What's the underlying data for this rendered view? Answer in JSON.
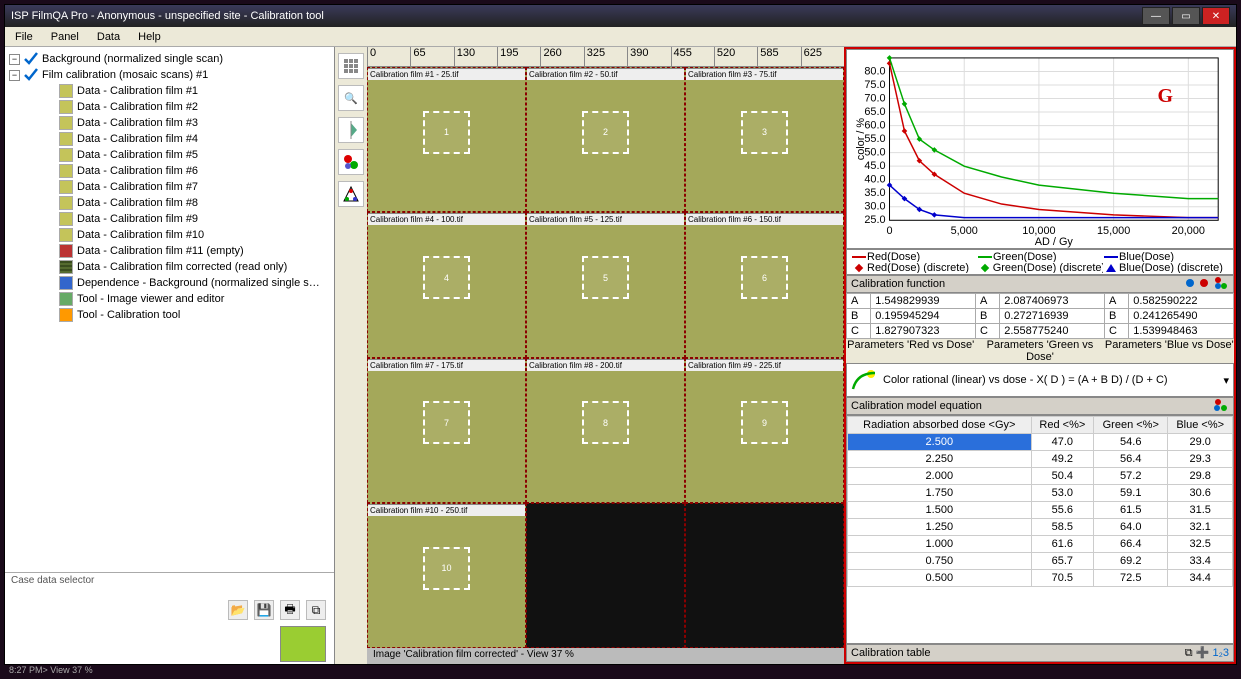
{
  "window": {
    "title": "ISP FilmQA Pro - Anonymous - unspecified site - Calibration tool"
  },
  "menubar": [
    "File",
    "Panel",
    "Data",
    "Help"
  ],
  "tree": {
    "root1": "Background (normalized single scan)",
    "root2": "Film calibration (mosaic scans) #1",
    "items": [
      "Data - Calibration film #1",
      "Data - Calibration film #2",
      "Data - Calibration film #3",
      "Data - Calibration film #4",
      "Data - Calibration film #5",
      "Data - Calibration film #6",
      "Data - Calibration film #7",
      "Data - Calibration film #8",
      "Data - Calibration film #9",
      "Data - Calibration film #10"
    ],
    "empty": "Data - Calibration film #11 (empty)",
    "corrected": "Data - Calibration film corrected (read only)",
    "dep": "Dependence - Background (normalized single s…",
    "tool1": "Tool - Image viewer and editor",
    "tool2": "Tool - Calibration tool"
  },
  "case_selector": "Case data selector",
  "rulerX": [
    "0",
    "65",
    "130",
    "195",
    "260",
    "325",
    "390",
    "455",
    "520",
    "585",
    "625"
  ],
  "filmLabels": [
    "Calibration film #1 - 25.tif",
    "Calibration film #2 - 50.tif",
    "Calibration film #3 - 75.tif",
    "Calibration film #4 - 100.tif",
    "Calibration film #5 - 125.tif",
    "Calibration film #6 - 150.tif",
    "Calibration film #7 - 175.tif",
    "Calibration film #8 - 200.tif",
    "Calibration film #9 - 225.tif",
    "Calibration film #10 - 250.tif",
    "",
    ""
  ],
  "roiNums": [
    "1",
    "2",
    "3",
    "4",
    "5",
    "6",
    "7",
    "8",
    "9",
    "10"
  ],
  "imgcaption": "Image 'Calibration film corrected' - View 37 %",
  "annotG": "G",
  "legend": {
    "r": "Red(Dose)",
    "g": "Green(Dose)",
    "b": "Blue(Dose)",
    "rd": "Red(Dose) (discrete)",
    "gd": "Green(Dose) (discrete)",
    "bd": "Blue(Dose) (discrete)"
  },
  "chart_y_label": "color / %",
  "chart_x_label": "AD / Gy",
  "calfunc_label": "Calibration function",
  "params": {
    "red": {
      "A": "1.549829939",
      "B": "0.195945294",
      "C": "1.827907323"
    },
    "green": {
      "A": "2.087406973",
      "B": "0.272716939",
      "C": "2.558775240"
    },
    "blue": {
      "A": "0.582590222",
      "B": "0.241265490",
      "C": "1.539948463"
    }
  },
  "paramLabels": {
    "r": "Parameters 'Red vs Dose'",
    "g": "Parameters 'Green vs Dose'",
    "b": "Parameters 'Blue vs Dose'"
  },
  "equation_label": "Color rational (linear) vs dose - X( D ) = (A + B D) / (D + C)",
  "modelhdr": "Calibration model equation",
  "caltable": {
    "headers": [
      "Radiation absorbed dose <Gy>",
      "Red <%>",
      "Green <%>",
      "Blue <%>"
    ],
    "rows": [
      [
        "2.500",
        "47.0",
        "54.6",
        "29.0"
      ],
      [
        "2.250",
        "49.2",
        "56.4",
        "29.3"
      ],
      [
        "2.000",
        "50.4",
        "57.2",
        "29.8"
      ],
      [
        "1.750",
        "53.0",
        "59.1",
        "30.6"
      ],
      [
        "1.500",
        "55.6",
        "61.5",
        "31.5"
      ],
      [
        "1.250",
        "58.5",
        "64.0",
        "32.1"
      ],
      [
        "1.000",
        "61.6",
        "66.4",
        "32.5"
      ],
      [
        "0.750",
        "65.7",
        "69.2",
        "33.4"
      ],
      [
        "0.500",
        "70.5",
        "72.5",
        "34.4"
      ]
    ],
    "footer": "Calibration table"
  },
  "footer": "8:27 PM> View 37 %",
  "chart_data": {
    "type": "line",
    "xlabel": "AD / Gy",
    "ylabel": "color / %",
    "xlim": [
      0,
      22000
    ],
    "ylim": [
      25,
      85
    ],
    "x_ticks": [
      0,
      5000,
      10000,
      15000,
      20000
    ],
    "y_ticks": [
      25,
      30,
      35,
      40,
      45,
      50,
      55,
      60,
      65,
      70,
      75,
      80
    ],
    "x": [
      0,
      1000,
      2000,
      3000,
      5000,
      7500,
      10000,
      15000,
      20000,
      22000
    ],
    "series": [
      {
        "name": "Red(Dose)",
        "color": "#c00",
        "values": [
          83,
          58,
          47,
          42,
          35,
          31,
          29,
          27,
          26,
          26
        ]
      },
      {
        "name": "Green(Dose)",
        "color": "#0a0",
        "values": [
          85,
          68,
          55,
          51,
          45,
          41,
          38,
          35,
          33,
          33
        ]
      },
      {
        "name": "Blue(Dose)",
        "color": "#00c",
        "values": [
          38,
          33,
          29,
          27,
          26,
          26,
          26,
          26,
          26,
          26
        ]
      }
    ]
  }
}
